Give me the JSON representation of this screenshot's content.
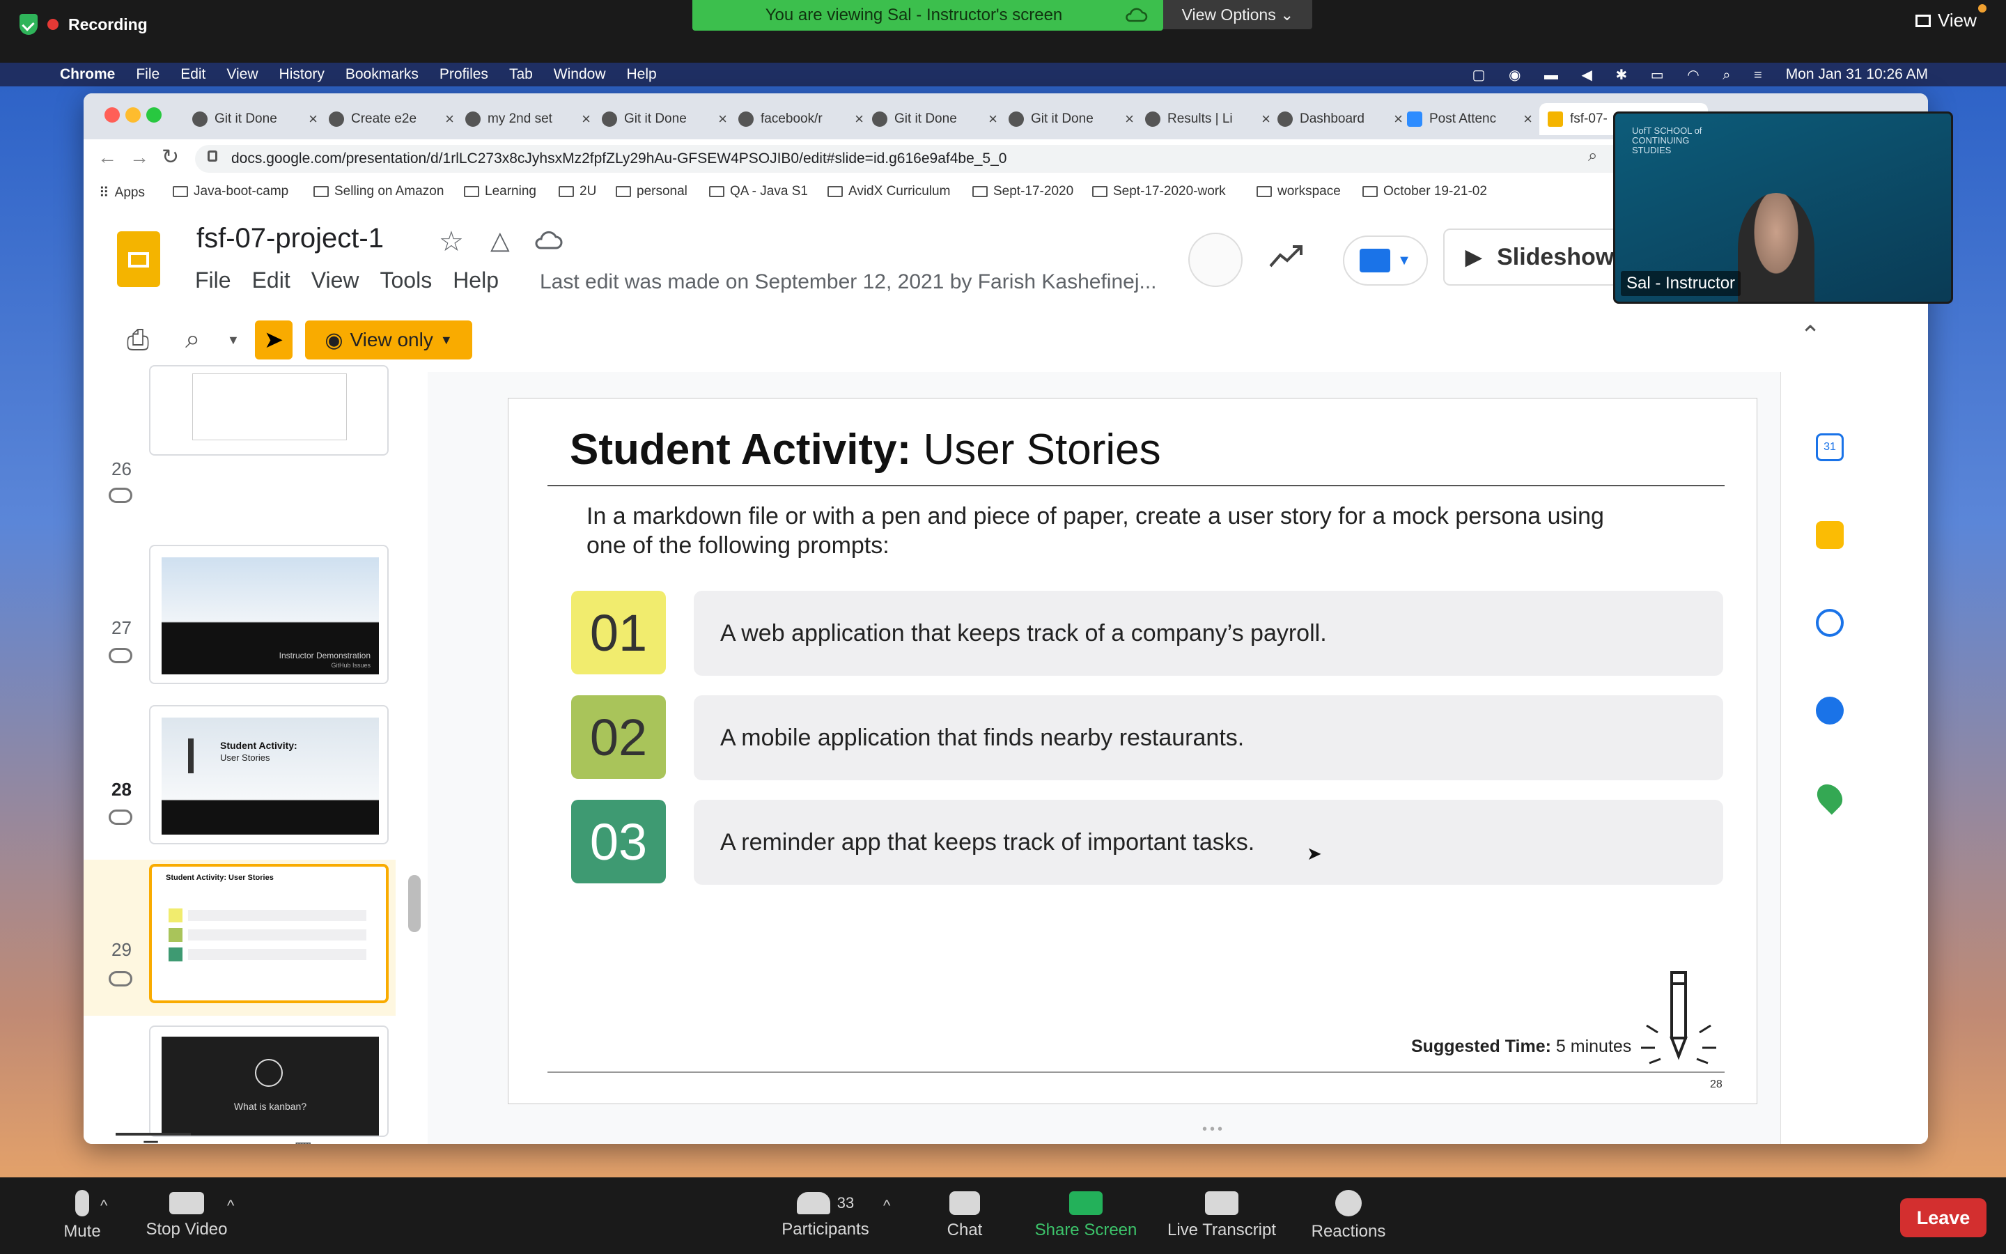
{
  "zoom": {
    "recording_label": "Recording",
    "viewing_banner": "You are viewing Sal - Instructor's screen",
    "view_options_label": "View Options",
    "view_label": "View",
    "toolbar": {
      "mute": "Mute",
      "stop_video": "Stop Video",
      "participants": "Participants",
      "participants_count": "33",
      "chat": "Chat",
      "share_screen": "Share Screen",
      "live_transcript": "Live Transcript",
      "reactions": "Reactions",
      "leave": "Leave"
    },
    "video_tile": {
      "name": "Sal - Instructor",
      "org_text": "UofT SCHOOL of CONTINUING STUDIES"
    }
  },
  "macbar": {
    "items": [
      "Chrome",
      "File",
      "Edit",
      "View",
      "History",
      "Bookmarks",
      "Profiles",
      "Tab",
      "Window",
      "Help"
    ],
    "datetime": "Mon Jan 31  10:26 AM"
  },
  "chrome": {
    "tabs": [
      {
        "label": "Git it Done"
      },
      {
        "label": "Create e2e"
      },
      {
        "label": "my 2nd set"
      },
      {
        "label": "Git it Done"
      },
      {
        "label": "facebook/r"
      },
      {
        "label": "Git it Done"
      },
      {
        "label": "Git it Done"
      },
      {
        "label": "Results | Li"
      },
      {
        "label": "Dashboard"
      },
      {
        "label": "Post Attenc"
      },
      {
        "label": "fsf-07-"
      }
    ],
    "url": "docs.google.com/presentation/d/1rlLC273x8cJyhsxMz2fpfZLy29hAu-GFSEW4PSOJIB0/edit#slide=id.g616e9af4be_5_0",
    "bookmarks": [
      "Apps",
      "Java-boot-camp",
      "Selling on Amazon",
      "Learning",
      "2U",
      "personal",
      "QA - Java S1",
      "AvidX Curriculum",
      "Sept-17-2020",
      "Sept-17-2020-work",
      "workspace",
      "October 19-21-02"
    ]
  },
  "slides": {
    "doc_title": "fsf-07-project-1",
    "menus": [
      "File",
      "Edit",
      "View",
      "Tools",
      "Help"
    ],
    "last_edit": "Last edit was made on September 12, 2021 by Farish Kashefinej...",
    "slideshow_label": "Slideshow",
    "view_only_label": "View only",
    "filmstrip": [
      {
        "num": "26",
        "caption": "Instructor Demonstration",
        "sub": "GitHub Issues"
      },
      {
        "num": "27",
        "title": "Student Activity:",
        "subtitle": "User Stories"
      },
      {
        "num": "28",
        "title": "Student Activity: User Stories"
      },
      {
        "num": "29",
        "caption": "What is kanban?"
      }
    ],
    "slide": {
      "title_bold": "Student Activity:",
      "title_rest": " User Stories",
      "intro": "In a markdown file or with a pen and piece of paper, create a user story for a mock persona using one of the following prompts:",
      "items": [
        {
          "num": "01",
          "text": "A web application that keeps track of a company’s payroll.",
          "color": "#f1ec6e"
        },
        {
          "num": "02",
          "text": "A mobile application that finds nearby restaurants.",
          "color": "#a9c45a"
        },
        {
          "num": "03",
          "text": "A reminder app that keeps track of important tasks.",
          "color": "#3e9a72"
        }
      ],
      "suggested_label": "Suggested Time:",
      "suggested_value": " 5 minutes",
      "page_number": "28"
    }
  }
}
